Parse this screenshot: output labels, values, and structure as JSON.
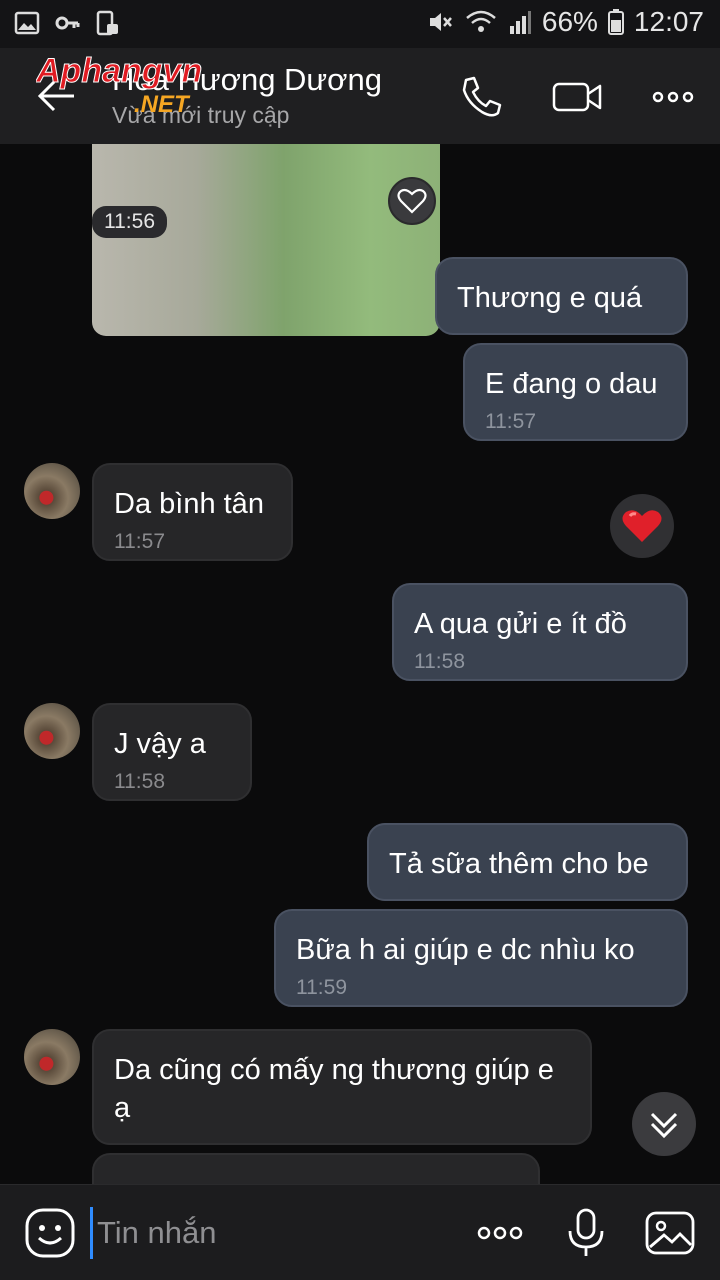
{
  "status_bar": {
    "battery": "66%",
    "time": "12:07"
  },
  "header": {
    "contact_name": "Hoa Hương Dương",
    "contact_status": "Vừa mới truy cập",
    "watermark_text": "Aphangvn",
    "watermark_sub": ".NET"
  },
  "chat": {
    "photo_time": "11:56",
    "messages": [
      {
        "dir": "out",
        "text": "Thương  e quá",
        "time": ""
      },
      {
        "dir": "out",
        "text": "E đang o dau",
        "time": "11:57"
      },
      {
        "dir": "in",
        "text": "Da bình tân",
        "time": "11:57"
      },
      {
        "dir": "out",
        "text": "A qua gửi  e ít  đồ",
        "time": "11:58"
      },
      {
        "dir": "in",
        "text": "J vậy a",
        "time": "11:58"
      },
      {
        "dir": "out",
        "text": "Tả sữa thêm cho be",
        "time": ""
      },
      {
        "dir": "out",
        "text": "Bữa h ai giúp  e dc nhìu ko",
        "time": "11:59"
      },
      {
        "dir": "in",
        "text": "Da cũng có mấy ng thương giúp e ạ",
        "time": ""
      }
    ],
    "reaction": "heart"
  },
  "composer": {
    "placeholder": "Tin nhắn"
  },
  "colors": {
    "accent": "#2f8cff",
    "bubble_out": "#3a4250",
    "bubble_in": "#262628",
    "heart": "#e0202a"
  }
}
